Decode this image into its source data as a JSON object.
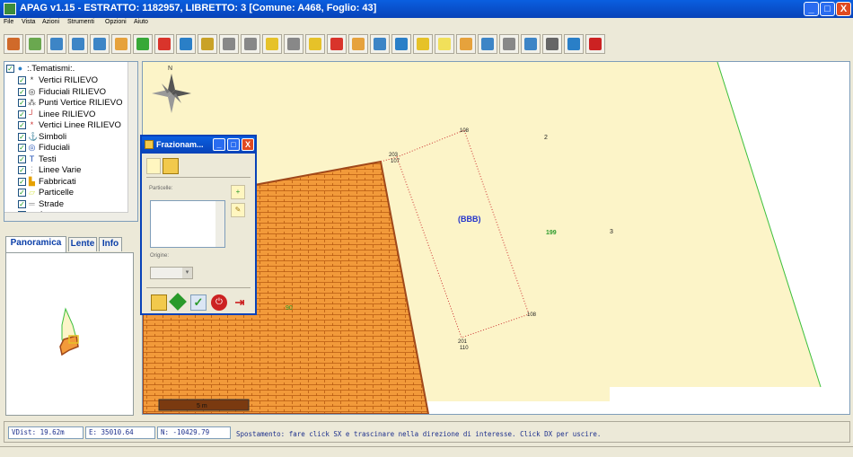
{
  "window": {
    "title": "APAG v1.15 - ESTRATTO: 1182957, LIBRETTO: 3 [Comune: A468, Foglio: 43]",
    "minimize_label": "_",
    "maximize_label": "□",
    "close_label": "X"
  },
  "menu": [
    "File",
    "Vista",
    "Azioni",
    "Strumenti",
    "Opzioni",
    "Aiuto"
  ],
  "toolbar": {
    "buttons": [
      {
        "icon": "zoom-icon",
        "color": "#d06a2a"
      },
      {
        "icon": "zoom-extent-icon",
        "color": "#6aa84f"
      },
      {
        "icon": "zoom-in-icon",
        "color": "#3d85c6"
      },
      {
        "icon": "zoom-out-icon",
        "color": "#3d85c6"
      },
      {
        "icon": "zoom-window-icon",
        "color": "#3d85c6"
      },
      {
        "icon": "pan-hand-icon",
        "color": "#e6a23c"
      },
      {
        "icon": "grid-icon",
        "color": "#38a838"
      },
      {
        "icon": "fullscreen-icon",
        "color": "#d9342b"
      },
      {
        "icon": "globe-icon",
        "color": "#2a7fc7"
      },
      {
        "icon": "ruler-icon",
        "color": "#c9a227"
      },
      {
        "icon": "stamp-icon",
        "color": "#888888"
      },
      {
        "icon": "link-icon",
        "color": "#888888"
      },
      {
        "icon": "find-icon",
        "color": "#e6c229"
      },
      {
        "icon": "table-icon",
        "color": "#888888"
      },
      {
        "icon": "layers-icon",
        "color": "#e6c229"
      },
      {
        "icon": "point-icon",
        "color": "#d9342b"
      },
      {
        "icon": "edit-icon",
        "color": "#e6a23c"
      },
      {
        "icon": "color-icon",
        "color": "#3d85c6"
      },
      {
        "icon": "save-icon",
        "color": "#2a7fc7"
      },
      {
        "icon": "select-icon",
        "color": "#e6c229"
      },
      {
        "icon": "highlight-icon",
        "color": "#f1e05a"
      },
      {
        "icon": "pencil-icon",
        "color": "#e6a23c"
      },
      {
        "icon": "tools-icon",
        "color": "#3d85c6"
      },
      {
        "icon": "frame-icon",
        "color": "#888888"
      },
      {
        "icon": "grid-check-icon",
        "color": "#3d85c6"
      },
      {
        "icon": "print-icon",
        "color": "#666666"
      },
      {
        "icon": "help-icon",
        "color": "#2a7fc7"
      },
      {
        "icon": "power-icon",
        "color": "#cc2222"
      }
    ]
  },
  "layers": {
    "root": ":.Tematismi:.",
    "items": [
      {
        "label": "Vertici RILIEVO",
        "icon": "asterisk-icon",
        "glyph": "*",
        "color": "#333333"
      },
      {
        "label": "Fiduciali RILIEVO",
        "icon": "target-icon",
        "glyph": "◎",
        "color": "#333333"
      },
      {
        "label": "Punti Vertice RILIEVO",
        "icon": "vertex-icon",
        "glyph": "⁂",
        "color": "#666666"
      },
      {
        "label": "Linee RILIEVO",
        "icon": "line-icon",
        "glyph": "┘",
        "color": "#cc3333"
      },
      {
        "label": "Vertici Linee RILIEVO",
        "icon": "asterisk-icon",
        "glyph": "*",
        "color": "#cc3333"
      },
      {
        "label": "Simboli",
        "icon": "anchor-icon",
        "glyph": "⚓",
        "color": "#1f4fb3"
      },
      {
        "label": "Fiduciali",
        "icon": "target-icon",
        "glyph": "◎",
        "color": "#1f4fb3"
      },
      {
        "label": "Testi",
        "icon": "text-icon",
        "glyph": "T",
        "color": "#1f4fb3"
      },
      {
        "label": "Linee Varie",
        "icon": "lines-icon",
        "glyph": "⋮",
        "color": "#999999"
      },
      {
        "label": "Fabbricati",
        "icon": "building-icon",
        "glyph": "▙",
        "color": "#e6a100"
      },
      {
        "label": "Particelle",
        "icon": "parcel-icon",
        "glyph": "▱",
        "color": "#d9e85a"
      },
      {
        "label": "Strade",
        "icon": "road-icon",
        "glyph": "═",
        "color": "#999999"
      },
      {
        "label": "Acque",
        "icon": "water-icon",
        "glyph": "≈",
        "color": "#3d85c6"
      }
    ]
  },
  "side_tabs": [
    "Panoramica",
    "Lente",
    "Info"
  ],
  "map": {
    "north_label": "N",
    "labels": {
      "bbb": "(BBB)",
      "p199": "199",
      "p108_top": "108",
      "p108_bottom": "108",
      "p203": "203",
      "p107": "107",
      "p201": "201",
      "p110": "110",
      "p2": "2",
      "p3": "3",
      "p90": "90",
      "scale": "5 m"
    },
    "colors": {
      "background": "#fcf4c8",
      "building": "#f29a3a",
      "building_lines": "#b85a10",
      "building_outline": "#a0481a",
      "parcel_line": "#3cbf3c",
      "dotted_line": "#cc3333",
      "bbb_text": "#2233cc",
      "p199_text": "#2a9a2a"
    }
  },
  "dialog": {
    "title": "Frazionam...",
    "list_label": "Particelle:",
    "origin_label": "Origine:",
    "minimize_label": "_",
    "maximize_label": "□",
    "close_label": "X"
  },
  "status": {
    "vdist": "VDist: 19.62m",
    "east": "E: 35010.64",
    "north": "N: -10429.79",
    "message": "Spostamento: fare click SX e trascinare nella direzione di interesse. Click DX per uscire."
  }
}
